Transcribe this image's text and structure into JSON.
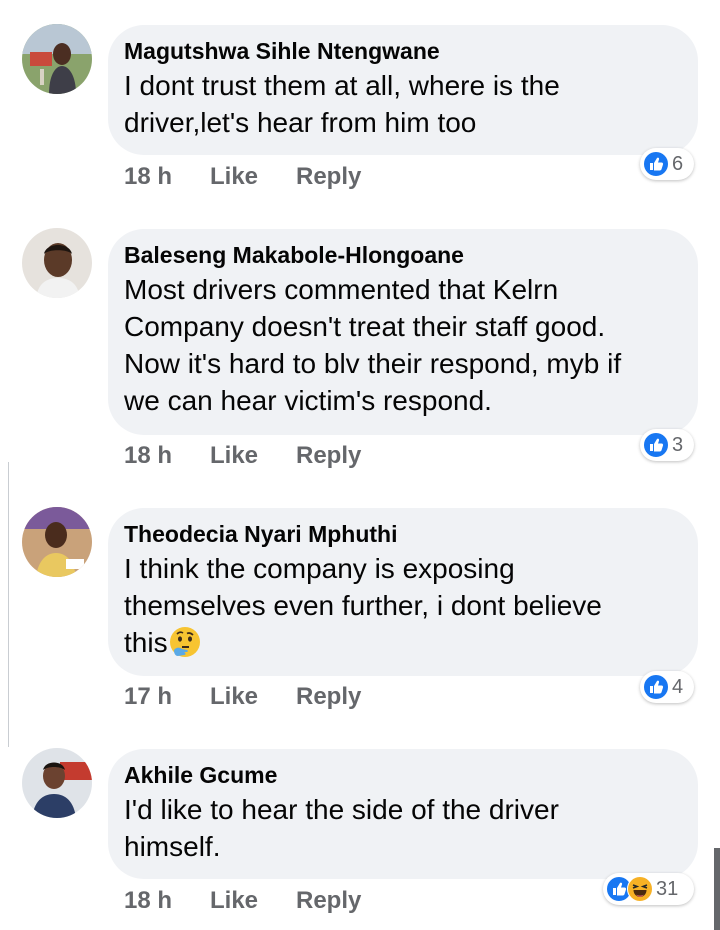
{
  "colors": {
    "bubble": "#f0f2f5",
    "text": "#050505",
    "secondary": "#65676b",
    "like_blue": "#1877f2",
    "haha_yellow": "#f7b125"
  },
  "comments": [
    {
      "author": "Magutshwa Sihle Ntengwane",
      "lines": [
        "I dont trust them at all, where is the",
        "driver,let's hear from him too"
      ],
      "time": "18 h",
      "like_label": "Like",
      "reply_label": "Reply",
      "reactions": [
        "like-icon"
      ],
      "reaction_count": "6"
    },
    {
      "author": "Baleseng Makabole-Hlongoane",
      "lines": [
        "Most drivers commented that Kelrn",
        "Company doesn't treat their staff good.",
        "Now it's hard to blv their respond, myb if",
        "we can hear victim's respond."
      ],
      "time": "18 h",
      "like_label": "Like",
      "reply_label": "Reply",
      "reactions": [
        "like-icon"
      ],
      "reaction_count": "3"
    },
    {
      "author": "Theodecia Nyari Mphuthi",
      "lines": [
        "I think the company is exposing",
        "themselves even further, i dont believe",
        "this"
      ],
      "emoji": "thinking-face-emoji",
      "time": "17 h",
      "like_label": "Like",
      "reply_label": "Reply",
      "reactions": [
        "like-icon"
      ],
      "reaction_count": "4"
    },
    {
      "author": "Akhile Gcume",
      "lines": [
        "I'd like to hear the side of the driver",
        "himself."
      ],
      "time": "18 h",
      "like_label": "Like",
      "reply_label": "Reply",
      "reactions": [
        "like-icon",
        "haha-icon"
      ],
      "reaction_count": "31"
    }
  ]
}
